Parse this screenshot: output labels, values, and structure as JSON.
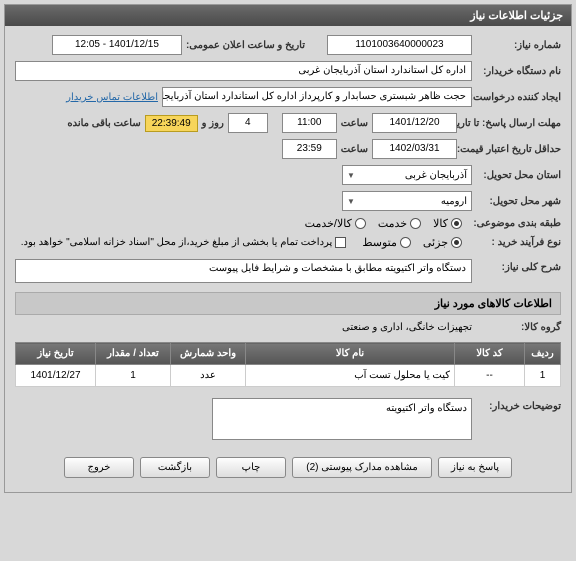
{
  "panel_title": "جزئیات اطلاعات نیاز",
  "fields": {
    "need_no_label": "شماره نیاز:",
    "need_no": "1101003640000023",
    "ann_dt_label": "تاریخ و ساعت اعلان عمومی:",
    "ann_dt": "1401/12/15 - 12:05",
    "buyer_org_label": "نام دستگاه خریدار:",
    "buyer_org": "اداره کل استاندارد استان آذربایجان غربی",
    "creator_label": "ایجاد کننده درخواست:",
    "creator": "حجت ظاهر شبستری حسابدار و کارپرداز اداره کل استاندارد استان آذربایجان غربی",
    "contact_link": "اطلاعات تماس خریدار",
    "response_deadline_label": "مهلت ارسال پاسخ: تا تاریخ:",
    "resp_date": "1401/12/20",
    "time_label": "ساعت",
    "resp_time": "11:00",
    "day_word": "روز و",
    "days_left": "4",
    "countdown": "22:39:49",
    "remain_suffix": "ساعت باقی مانده",
    "price_valid_label": "حداقل تاریخ اعتبار قیمت: تا تاریخ:",
    "price_date": "1402/03/31",
    "price_time": "23:59",
    "province_label": "استان محل تحویل:",
    "province": "آذربایجان غربی",
    "city_label": "شهر محل تحویل:",
    "city": "ارومیه",
    "cat_label": "طبقه بندی موضوعی:",
    "cat_goods": "کالا",
    "cat_service": "خدمت",
    "cat_both": "کالا/خدمت",
    "process_label": "نوع فرآیند خرید :",
    "proc_low": "جزئی",
    "proc_mid": "متوسط",
    "pay_note": "پرداخت تمام یا بخشی از مبلغ خرید،از محل \"اسناد خزانه اسلامی\" خواهد بود.",
    "desc_label": "شرح کلی نیاز:",
    "desc": "دستگاه واتر اکتیویته مطابق با مشخصات و شرایط فایل پیوست",
    "items_title": "اطلاعات کالاهای مورد نیاز",
    "group_label": "گروه کالا:",
    "group": "تجهیزات خانگی، اداری و صنعتی",
    "buyer_notes_label": "توضیحات خریدار:",
    "buyer_notes": "دستگاه واتر اکتیویته"
  },
  "columns": {
    "row": "ردیف",
    "code": "کد کالا",
    "name": "نام کالا",
    "unit": "واحد شمارش",
    "qty": "تعداد / مقدار",
    "date": "تاریخ نیاز"
  },
  "rows": [
    {
      "row": "1",
      "code": "--",
      "name": "کیت یا محلول تست آب",
      "unit": "عدد",
      "qty": "1",
      "date": "1401/12/27"
    }
  ],
  "buttons": {
    "reply": "پاسخ به نیاز",
    "attach": "مشاهده مدارک پیوستی (2)",
    "print": "چاپ",
    "back": "بازگشت",
    "exit": "خروج"
  }
}
